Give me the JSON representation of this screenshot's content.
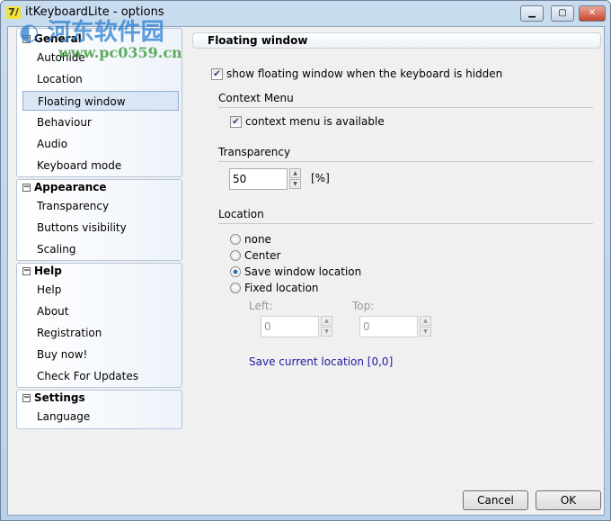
{
  "window": {
    "title": "itKeyboardLite - options",
    "icon": "app-logo-icon"
  },
  "sidebar": {
    "groups": [
      {
        "label": "General",
        "items": [
          "Autohide",
          "Location",
          "Floating window",
          "Behaviour",
          "Audio",
          "Keyboard mode"
        ]
      },
      {
        "label": "Appearance",
        "items": [
          "Transparency",
          "Buttons visibility",
          "Scaling"
        ]
      },
      {
        "label": "Help",
        "items": [
          "Help",
          "About",
          "Registration",
          "Buy now!",
          "Check For Updates"
        ]
      },
      {
        "label": "Settings",
        "items": [
          "Language"
        ]
      }
    ],
    "selected": "Floating window"
  },
  "panel": {
    "title": "Floating window",
    "show_floating": {
      "label": "show floating window when the keyboard is hidden",
      "checked": true
    },
    "context_menu": {
      "title": "Context Menu",
      "label": "context menu is available",
      "checked": true
    },
    "transparency": {
      "title": "Transparency",
      "value": "50",
      "unit": "[%]"
    },
    "location": {
      "title": "Location",
      "options": [
        "none",
        "Center",
        "Save window location",
        "Fixed location"
      ],
      "selected": "Save window location",
      "left_label": "Left:",
      "left_value": "0",
      "top_label": "Top:",
      "top_value": "0",
      "save_link": "Save current location [0,0]"
    }
  },
  "buttons": {
    "cancel": "Cancel",
    "ok": "OK"
  },
  "watermark": {
    "text": "河东软件园",
    "url": "www.pc0359.cn"
  }
}
